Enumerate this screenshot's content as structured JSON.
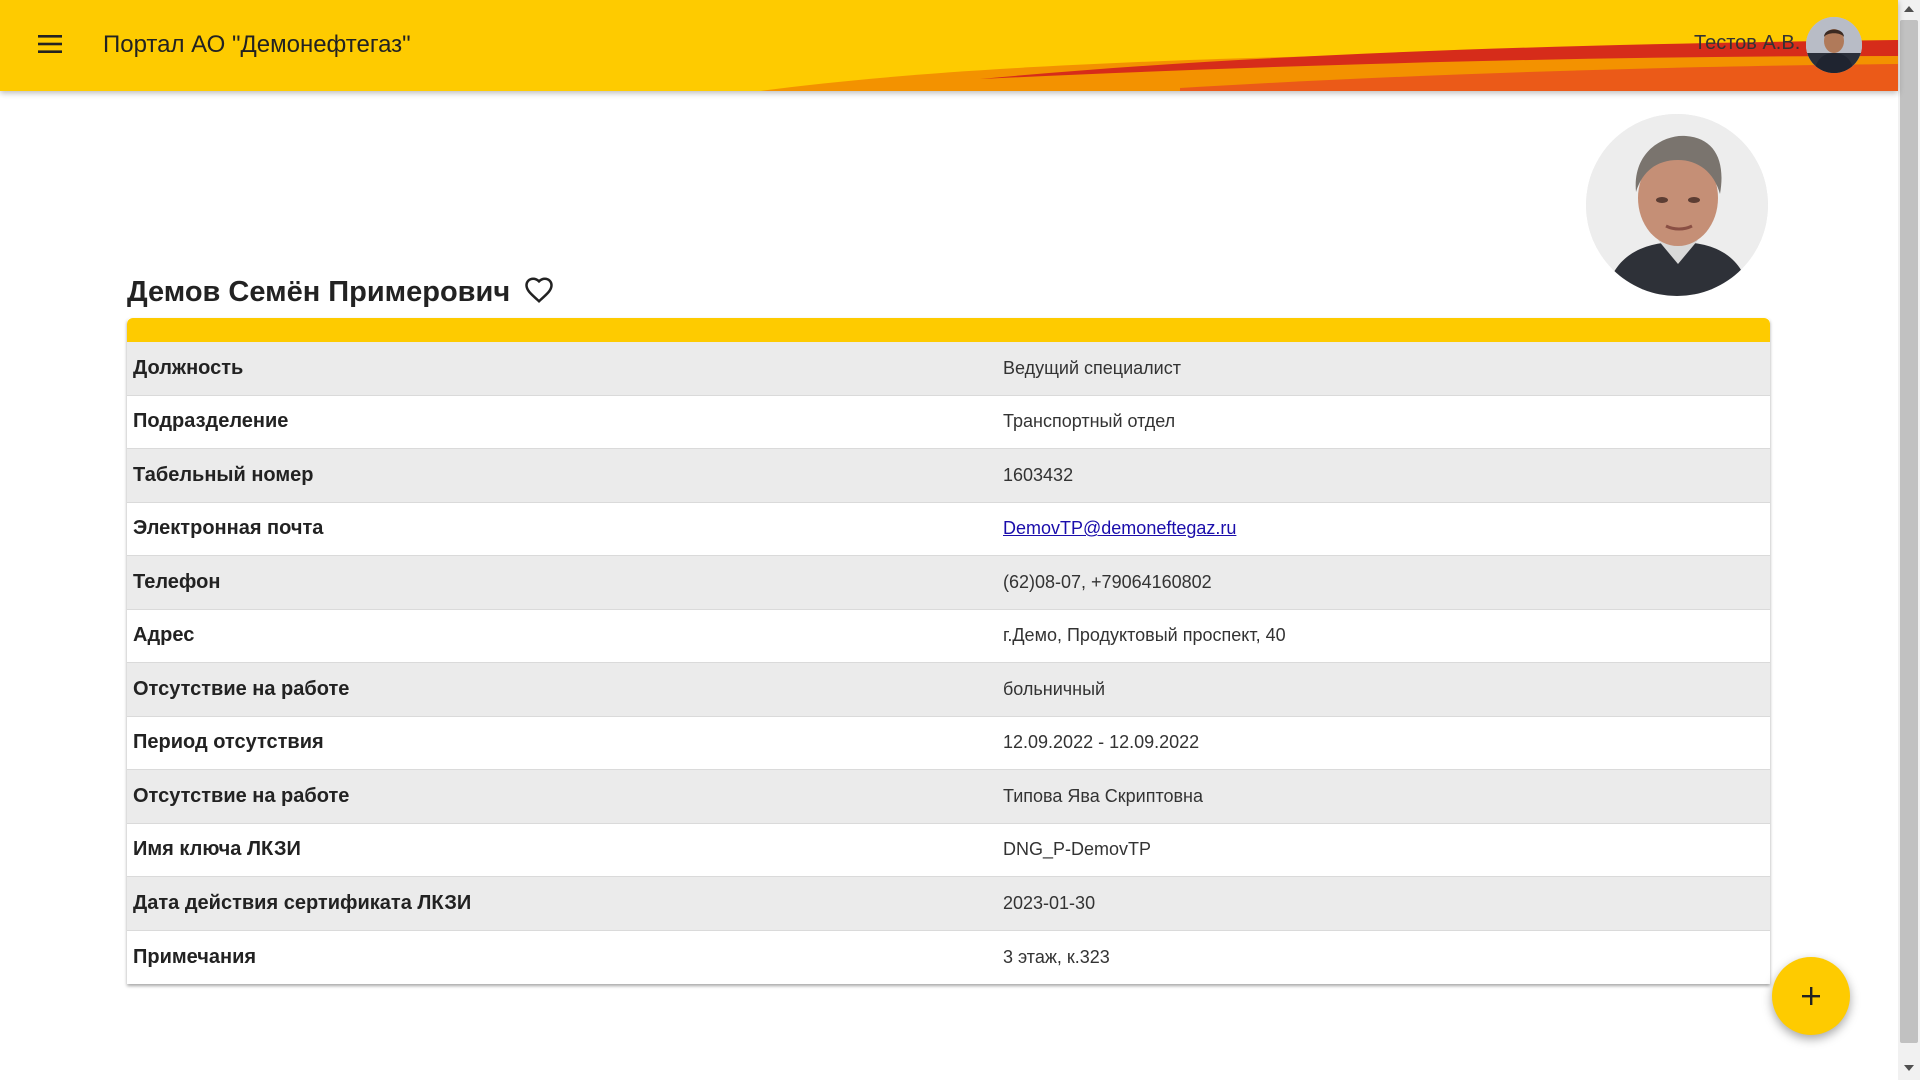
{
  "header": {
    "title": "Портал АО \"Демонефтегаз\"",
    "user_name": "Тестов А.В.",
    "menu_icon": "menu-icon",
    "brand_colors": {
      "yellow": "#fecb00",
      "orange": "#f39200",
      "red": "#d62c1a"
    }
  },
  "profile": {
    "name": "Демов Семён Примерович",
    "favorite_icon": "heart-outline-icon",
    "fields": [
      {
        "label": "Должность",
        "value": "Ведущий специалист"
      },
      {
        "label": "Подразделение",
        "value": "Транспортный отдел"
      },
      {
        "label": "Табельный номер",
        "value": "1603432"
      },
      {
        "label": "Электронная почта",
        "value": "DemovTP@demoneftegaz.ru"
      },
      {
        "label": "Телефон",
        "value": "(62)08-07, +79064160802"
      },
      {
        "label": "Адрес",
        "value": "г.Демо, Продуктовый проспект, 40"
      },
      {
        "label": "Отсутствие на работе",
        "value": "больничный"
      },
      {
        "label": "Период отсутствия",
        "value": "12.09.2022 - 12.09.2022"
      },
      {
        "label": "Отсутствие на работе",
        "value": "Типова Ява Скриптовна"
      },
      {
        "label": "Имя ключа ЛКЗИ",
        "value": "DNG_P-DemovTP"
      },
      {
        "label": "Дата действия сертификата ЛКЗИ",
        "value": "2023-01-30"
      },
      {
        "label": "Примечания",
        "value": "3 этаж, к.323"
      }
    ]
  },
  "fab": {
    "label": "+",
    "icon": "plus-icon"
  }
}
